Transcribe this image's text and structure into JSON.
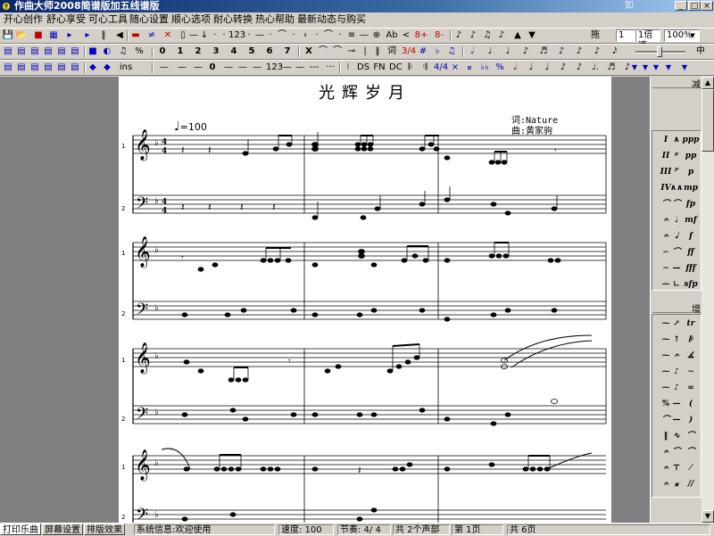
{
  "window": {
    "title": "作曲大师2008简谱版加五线谱版",
    "watermark": "如",
    "buttons": [
      "_",
      "□",
      "×"
    ]
  },
  "menu": [
    "开心创作",
    "舒心享受",
    "可心工具",
    "随心设置",
    "顺心选项",
    "耐心转换",
    "热心帮助",
    "最新动态与购买"
  ],
  "toolbar1": {
    "items": [
      "💾",
      "📂",
      "■",
      "▦",
      "▸",
      "▸",
      "‖",
      "◀",
      "▬",
      "≠",
      "✕",
      "▯",
      "—",
      "↓",
      "·",
      "·",
      "123",
      "·",
      "—",
      "·",
      "⌒",
      "·",
      "›",
      "·",
      "⌒",
      "·",
      "≡",
      "—",
      "⊕",
      "Ab",
      "<",
      "8+",
      "8-",
      "♪",
      "♪",
      "♫",
      "♪",
      "▲",
      "▼"
    ],
    "drag_label": "拖",
    "speed_value": "1",
    "speed_unit": "1倍速",
    "zoom_value": "100%"
  },
  "toolbar2": {
    "items": [
      "■",
      "◐",
      "♫",
      "%",
      "0",
      "1",
      "2",
      "3",
      "4",
      "5",
      "6",
      "7",
      "X",
      "⌒",
      "⌒",
      "⊸",
      "|",
      "‖",
      "词",
      "3/4",
      "#",
      "♭",
      "♫",
      "𝅗𝅥",
      "♩",
      "♩",
      "♪",
      "♬",
      "♪",
      "♪",
      "♪",
      "𝅘𝅥𝅯"
    ],
    "right_label": "中"
  },
  "toolbar3": {
    "items": [
      "◆",
      "◆",
      "ins",
      "—",
      "—",
      "—",
      "0",
      "—",
      "—",
      "—",
      "123",
      "—",
      "—",
      "---",
      "···",
      "⁝",
      "DS",
      "FN",
      "DC",
      "𝄆",
      "𝄇",
      "4/4",
      "×",
      "𝄪",
      "♭♭",
      "%",
      "𝅗𝅥",
      "♩",
      "♩",
      "♪",
      "♪",
      "♩.",
      "♬",
      "♪"
    ]
  },
  "score": {
    "title": "光辉岁月",
    "lyricist": "词:Nature",
    "composer": "曲:黄家驹",
    "tempo": "=100",
    "time_signature": "4/4",
    "part_numbers": [
      "1",
      "2"
    ]
  },
  "palette": {
    "top_label": "减",
    "middle_label": "增",
    "dynamics_a": [
      "I",
      "∧",
      "ppp",
      "II",
      "ᵖ",
      "pp",
      "III",
      "ᴾ",
      "p",
      "IV",
      "∧∧",
      "mp",
      "⌒",
      "⌒",
      "fp",
      "𝄐",
      "♩",
      "mf",
      "𝄐",
      "𝅘𝅥",
      "f",
      "∽",
      "⌒",
      "ff",
      "∼",
      "—",
      "fff",
      "⁓",
      "∟",
      "sfp"
    ],
    "dynamics_b": [
      "⁓",
      "↗",
      "tr",
      "⁓",
      "↑",
      "𝄆",
      "⁓",
      "𝄐",
      "∡",
      "⁓",
      "♪",
      "∼",
      "⁓",
      "♪",
      "∞",
      "%",
      "—",
      "(",
      "⌒",
      "—",
      ")",
      "‖",
      "∿",
      "⌒",
      "𝄐",
      "⌒",
      "⌒",
      "𝄐",
      "⊤",
      "⁄",
      "𝄐",
      "𝄪",
      "//"
    ]
  },
  "status": {
    "tabs": [
      "打印乐曲",
      "屏幕设置",
      "排版效果"
    ],
    "system_info": "系统信息:欢迎使用",
    "speed": "速度: 100",
    "beat": "节奏: 4/ 4",
    "voices": "共 2个声部",
    "page": "第 1页",
    "total_pages": "共 6页"
  }
}
